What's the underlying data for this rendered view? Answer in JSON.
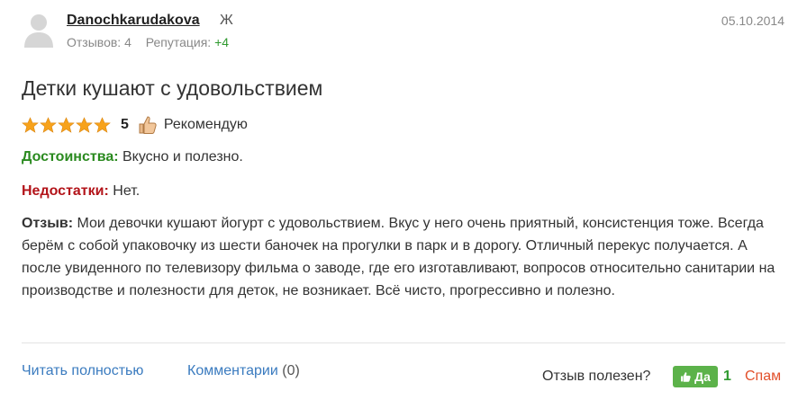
{
  "author": {
    "username": "Danochkarudakova",
    "gender": "Ж",
    "reviews_label": "Отзывов: 4",
    "reputation_label": "Репутация:",
    "reputation_value": "+4"
  },
  "date": "05.10.2014",
  "review": {
    "title": "Детки кушают с удовольствием",
    "rating": 5,
    "rating_text": "5",
    "recommend_label": "Рекомендую",
    "pros_label": "Достоинства:",
    "pros_text": "Вкусно и полезно.",
    "cons_label": "Недостатки:",
    "cons_text": "Нет.",
    "body_label": "Отзыв:",
    "body_text": "Мои девочки кушают йогурт с удовольствием. Вкус у него очень приятный, консистенция тоже. Всегда берём с собой упаковочку из шести баночек на прогулки в парк и в дорогу. Отличный перекус получается. А после увиденного по телевизору фильма о заводе, где его изготавливают, вопросов относительно санитарии на производстве и полезности для деток, не возникает. Всё чисто, прогрессивно и полезно."
  },
  "footer": {
    "read_full": "Читать полностью",
    "comments_label": "Комментарии",
    "comments_count": "(0)",
    "helpful_label": "Отзыв полезен?",
    "yes_label": "Да",
    "yes_count": "1",
    "spam_label": "Спам"
  },
  "colors": {
    "pros": "#2a8a1f",
    "cons": "#b3141a",
    "link": "#3a7bbf",
    "yes_button": "#5cb24a",
    "spam": "#e2502b",
    "star": "#f7a21b"
  },
  "icons": {
    "avatar": "user-avatar-icon",
    "star": "star-icon",
    "recommend": "thumbs-up-icon",
    "yes": "thumbs-up-icon"
  }
}
